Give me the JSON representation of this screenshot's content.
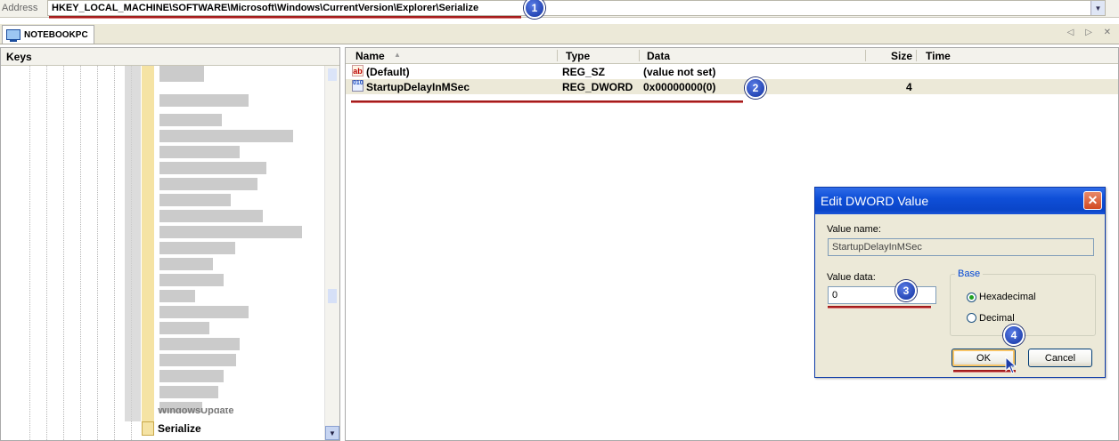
{
  "address": {
    "label": "Address",
    "path": "HKEY_LOCAL_MACHINE\\SOFTWARE\\Microsoft\\Windows\\CurrentVersion\\Explorer\\Serialize",
    "dropdown_icon": "chevron-down-icon"
  },
  "tab": {
    "label": "NOTEBOOKPC",
    "icon": "computer-icon",
    "nav": "◁ ▷ ✕"
  },
  "keys": {
    "title": "Keys",
    "selected_item": "Serialize",
    "partial_item": "WindowsUpdate"
  },
  "values": {
    "columns": {
      "name": "Name",
      "type": "Type",
      "data": "Data",
      "size": "Size",
      "time": "Time"
    },
    "rows": [
      {
        "icon": "ab",
        "name": "(Default)",
        "type": "REG_SZ",
        "data": "(value not set)",
        "size": ""
      },
      {
        "icon": "010",
        "name": "StartupDelayInMSec",
        "type": "REG_DWORD",
        "data": "0x00000000(0)",
        "size": "4"
      }
    ]
  },
  "dialog": {
    "title": "Edit DWORD Value",
    "value_name_label": "Value name:",
    "value_name": "StartupDelayInMSec",
    "value_data_label": "Value data:",
    "value_data": "0",
    "base_label": "Base",
    "hex_label": "Hexadecimal",
    "dec_label": "Decimal",
    "selected_base": "Hexadecimal",
    "ok_label": "OK",
    "cancel_label": "Cancel"
  },
  "annotations": {
    "step1": "1",
    "step2": "2",
    "step3": "3",
    "step4": "4",
    "color": "#a31c1c",
    "badge_color": "#1a3ccf"
  }
}
